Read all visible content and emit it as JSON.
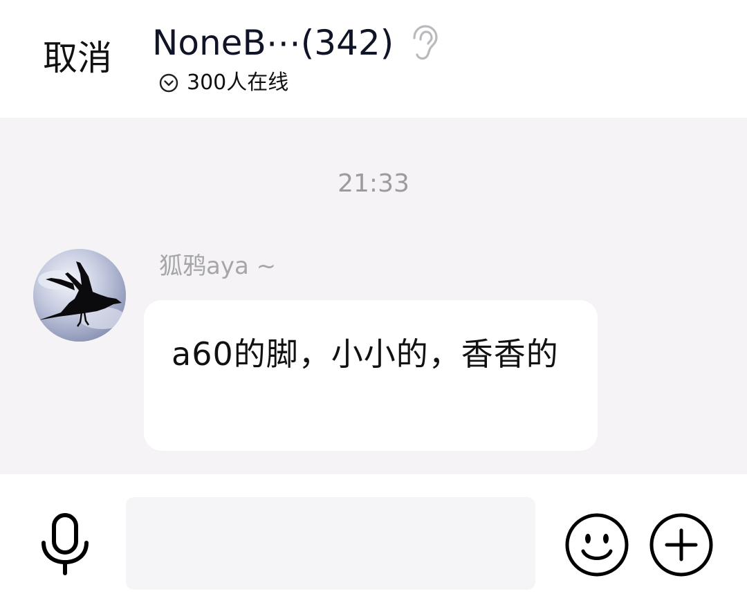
{
  "header": {
    "cancel_label": "取消",
    "group_title": "NoneB⋯(342)",
    "online_text": "300人在线"
  },
  "chat": {
    "timestamp": "21:33",
    "messages": [
      {
        "sender": "狐鸦aya ~",
        "text": "a60的脚，小小的，香香的"
      }
    ]
  },
  "input_bar": {
    "placeholder": "",
    "value": ""
  },
  "icons": {
    "ear": "ear-icon",
    "online_toggle": "chevron-down-circle-icon",
    "mic": "microphone-icon",
    "emoji": "smiley-icon",
    "plus": "plus-circle-icon"
  },
  "colors": {
    "chat_background": "#f5f3f6",
    "secondary_text": "#9a9a9f",
    "bubble": "#ffffff"
  }
}
